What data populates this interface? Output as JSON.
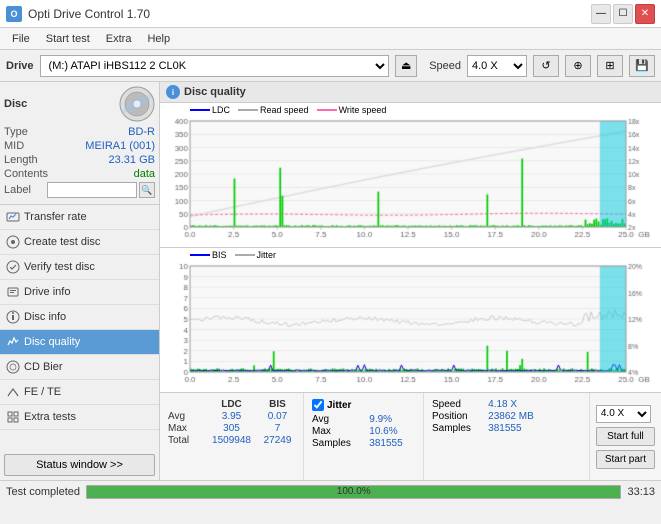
{
  "titlebar": {
    "title": "Opti Drive Control 1.70",
    "min_btn": "—",
    "max_btn": "☐",
    "close_btn": "✕"
  },
  "menubar": {
    "items": [
      "File",
      "Start test",
      "Extra",
      "Help"
    ]
  },
  "drivebar": {
    "label": "Drive",
    "drive_value": "(M:) ATAPI iHBS112  2 CL0K",
    "speed_label": "Speed",
    "speed_value": "4.0 X"
  },
  "sidebar": {
    "disc_title": "Disc",
    "disc_fields": [
      {
        "field": "Type",
        "value": "BD-R"
      },
      {
        "field": "MID",
        "value": "MEIRA1 (001)"
      },
      {
        "field": "Length",
        "value": "23.31 GB"
      },
      {
        "field": "Contents",
        "value": "data"
      },
      {
        "field": "Label",
        "value": ""
      }
    ],
    "menu_items": [
      {
        "label": "Transfer rate",
        "active": false
      },
      {
        "label": "Create test disc",
        "active": false
      },
      {
        "label": "Verify test disc",
        "active": false
      },
      {
        "label": "Drive info",
        "active": false
      },
      {
        "label": "Disc info",
        "active": false
      },
      {
        "label": "Disc quality",
        "active": true
      },
      {
        "label": "CD Bier",
        "active": false
      },
      {
        "label": "FE / TE",
        "active": false
      },
      {
        "label": "Extra tests",
        "active": false
      }
    ],
    "status_btn": "Status window >>"
  },
  "quality": {
    "title": "Disc quality",
    "chart1": {
      "legend": [
        {
          "label": "LDC",
          "color": "#0000ff"
        },
        {
          "label": "Read speed",
          "color": "#cccccc"
        },
        {
          "label": "Write speed",
          "color": "#ff69b4"
        }
      ],
      "y_max": 400,
      "y_right_max": 18,
      "x_max": 25,
      "right_labels": [
        "18x",
        "16x",
        "14x",
        "12x",
        "10x",
        "8x",
        "6x",
        "4x",
        "2x"
      ]
    },
    "chart2": {
      "legend": [
        {
          "label": "BIS",
          "color": "#0000ff"
        },
        {
          "label": "Jitter",
          "color": "#aaaaaa"
        }
      ],
      "y_max": 10,
      "y_right_max": 20,
      "x_max": 25
    }
  },
  "stats": {
    "col_headers": [
      "",
      "LDC",
      "BIS"
    ],
    "rows": [
      {
        "label": "Avg",
        "ldc": "3.95",
        "bis": "0.07"
      },
      {
        "label": "Max",
        "ldc": "305",
        "bis": "7"
      },
      {
        "label": "Total",
        "ldc": "1509948",
        "bis": "27249"
      }
    ],
    "jitter": {
      "label": "Jitter",
      "checked": true,
      "avg": "9.9%",
      "max": "10.6%",
      "samples": "381555"
    },
    "speed": {
      "label": "Speed",
      "value": "4.18 X",
      "speed_select": "4.0 X"
    },
    "position": {
      "label": "Position",
      "value": "23862 MB",
      "samples_label": "Samples"
    },
    "buttons": {
      "start_full": "Start full",
      "start_part": "Start part"
    }
  },
  "statusbar": {
    "text": "Test completed",
    "progress": 100,
    "progress_label": "100.0%",
    "time": "33:13"
  }
}
